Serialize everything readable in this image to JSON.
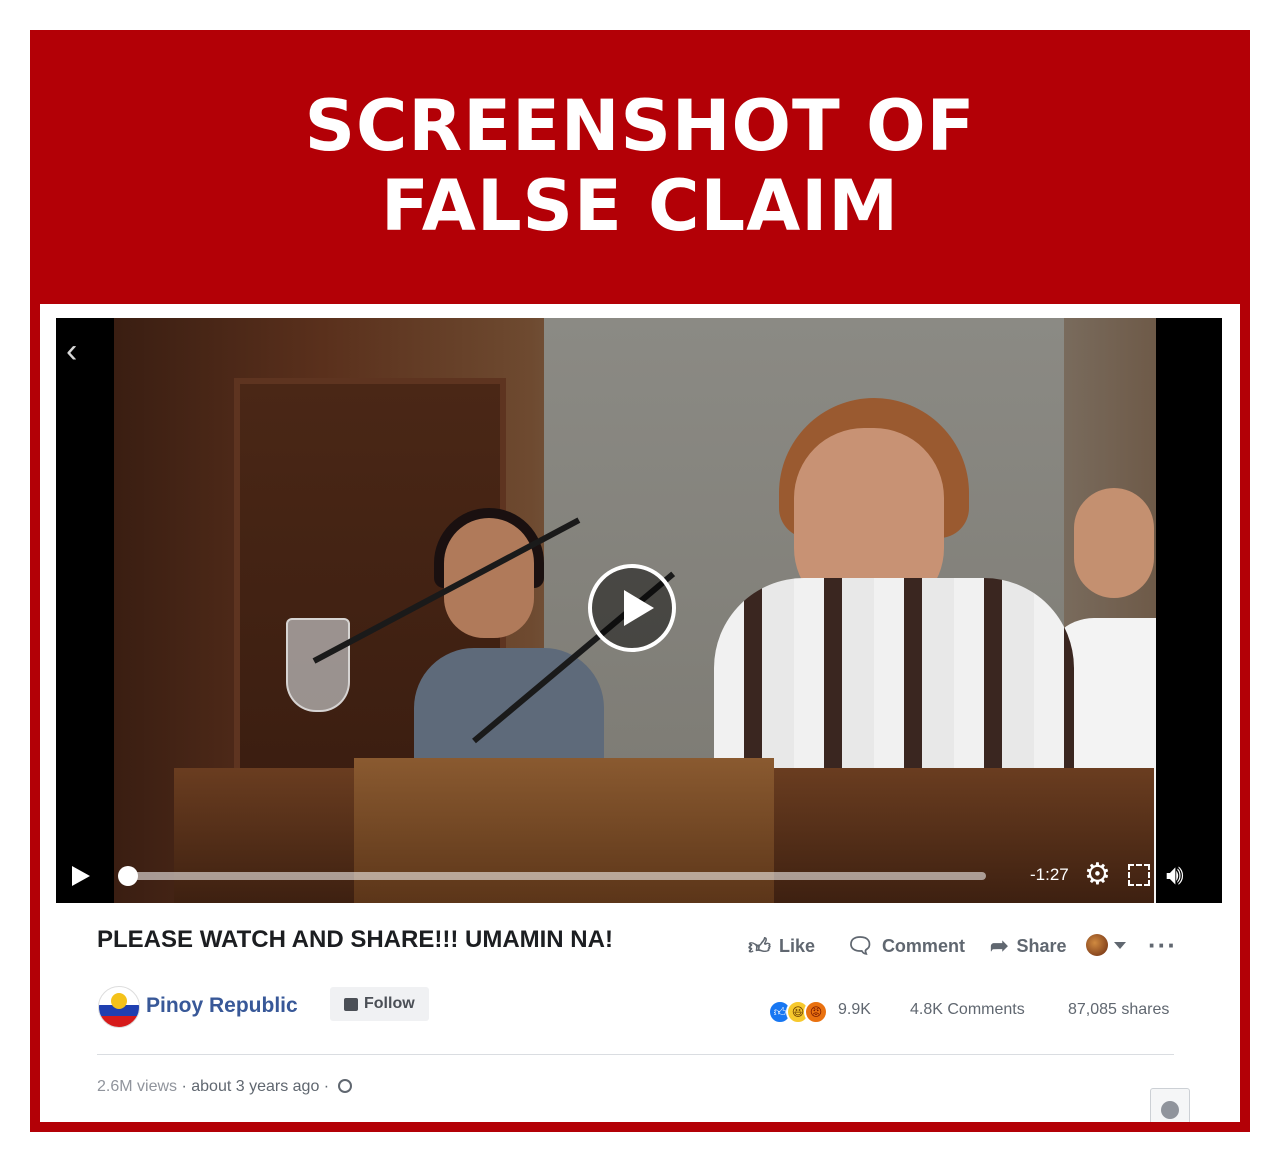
{
  "banner": {
    "line1": "SCREENSHOT OF",
    "line2": "FALSE CLAIM"
  },
  "video": {
    "back_icon": "chevron-left-icon",
    "remaining_time": "-1:27",
    "progress": 0.0,
    "icons": [
      "play-icon",
      "settings-gear-icon",
      "fullscreen-icon",
      "volume-icon"
    ]
  },
  "post": {
    "title": "PLEASE WATCH AND SHARE!!! UMAMIN NA!",
    "actions": {
      "like": "Like",
      "comment": "Comment",
      "share": "Share"
    },
    "page": {
      "name": "Pinoy Republic",
      "follow": "Follow"
    },
    "stats": {
      "reactions": "9.9K",
      "comments": "4.8K Comments",
      "shares": "87,085 shares"
    },
    "meta": {
      "views": "2.6M views",
      "separator": " · ",
      "age": "about 3 years ago",
      "separator2": " · "
    }
  },
  "colors": {
    "frame": "#b30006",
    "link": "#385898",
    "muted": "#606770"
  }
}
